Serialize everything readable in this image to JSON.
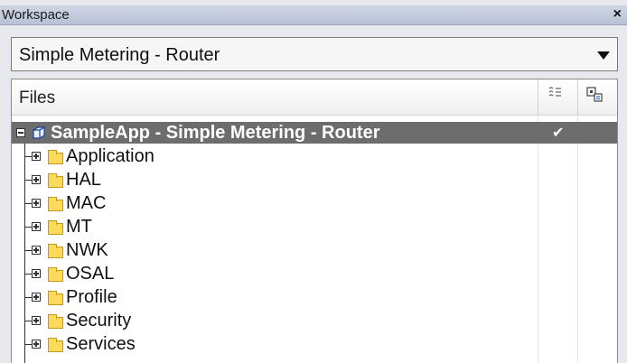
{
  "titlebar": {
    "title": "Workspace",
    "close_label": "×"
  },
  "dropdown": {
    "value": "Simple Metering - Router"
  },
  "tree": {
    "header": {
      "files_label": "Files",
      "col1_icon": "options-icon",
      "col2_icon": "output-icon"
    },
    "root": {
      "label": "SampleApp - Simple Metering - Router",
      "check": "✔"
    },
    "items": [
      {
        "label": "Application"
      },
      {
        "label": "HAL"
      },
      {
        "label": "MAC"
      },
      {
        "label": "MT"
      },
      {
        "label": "NWK"
      },
      {
        "label": "OSAL"
      },
      {
        "label": "Profile"
      },
      {
        "label": "Security"
      },
      {
        "label": "Services"
      }
    ]
  }
}
